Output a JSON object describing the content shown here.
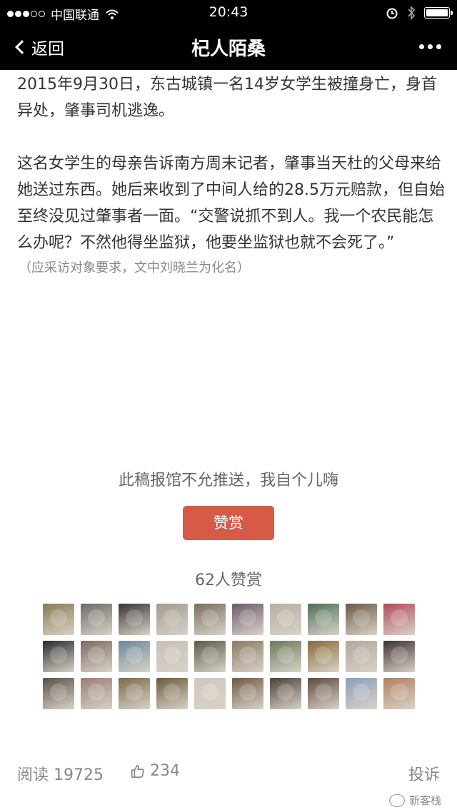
{
  "status_bar": {
    "carrier": "中国联通",
    "time": "20:43"
  },
  "nav": {
    "back_label": "返回",
    "title": "杞人陌桑"
  },
  "article": {
    "paragraphs": [
      "2015年9月30日，东古城镇一名14岁女学生被撞身亡，身首异处，肇事司机逃逸。",
      "这名女学生的母亲告诉南方周末记者，肇事当天杜的父母来给她送过东西。她后来收到了中间人给的28.5万元赔款，但自始至终没见过肇事者一面。“交警说抓不到人。我一个农民能怎么办呢？不然他得坐监狱，他要坐监狱也就不会死了。”"
    ],
    "note": "（应采访对象要求，文中刘晓兰为化名）"
  },
  "reward": {
    "slogan": "此稿报馆不允推送，我自个儿嗨",
    "button_label": "赞赏",
    "count_text": "62人赞赏",
    "button_color": "#d65a48"
  },
  "avatar_colors": [
    "#8a7a55",
    "#6f6a66",
    "#3a3333",
    "#a29a8f",
    "#7a6f5c",
    "#6c5a6b",
    "#b7aea2",
    "#4e6f57",
    "#6b5a43",
    "#b24a5a",
    "#2b2b2b",
    "#7d6a5f",
    "#6a8a9a",
    "#c8c0b8",
    "#5c5a44",
    "#8c7a62",
    "#6a7a5a",
    "#8a6a3a",
    "#b2a89a",
    "#3d3230",
    "#5a5048",
    "#9a7d70",
    "#7a6a4a",
    "#6a5a3a",
    "#d0c8c0",
    "#6f5a40",
    "#4a4038",
    "#5d4a3a",
    "#8aa0b8",
    "#b08060"
  ],
  "footer": {
    "read_text": "阅读 19725",
    "likes": "234",
    "report_label": "投诉"
  },
  "watermark": "新客栈"
}
